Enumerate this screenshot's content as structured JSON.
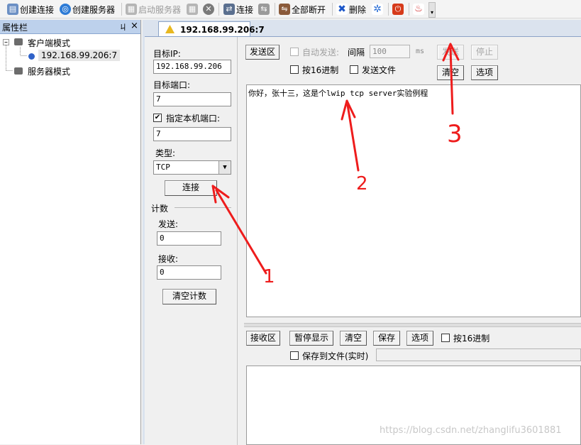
{
  "toolbar": {
    "create_connection": "创建连接",
    "create_server": "创建服务器",
    "start_server": "启动服务器",
    "connect": "连接",
    "disconnect_all": "全部断开",
    "delete": "删除"
  },
  "sidebar": {
    "title": "属性栏",
    "pin": "ㄐ",
    "close": "×",
    "client_mode": "客户端模式",
    "client_item": "192.168.99.206:7",
    "server_mode": "服务器模式"
  },
  "tab": {
    "label": "192.168.99.206:7"
  },
  "config": {
    "target_ip_label": "目标IP:",
    "target_ip": "192.168.99.206",
    "target_port_label": "目标端口:",
    "target_port": "7",
    "local_port_label": "指定本机端口:",
    "local_port": "7",
    "type_label": "类型:",
    "type_value": "TCP",
    "connect_button": "连接",
    "counter_label": "计数",
    "send_label": "发送:",
    "send_count": "0",
    "recv_label": "接收:",
    "recv_count": "0",
    "clear_count": "清空计数"
  },
  "send_area": {
    "title": "发送区",
    "auto_send": "自动发送:",
    "interval_label": "间隔",
    "interval_value": "100",
    "interval_unit": "ms",
    "send_button": "发送",
    "stop_button": "停止",
    "hex": "按16进制",
    "send_file": "发送文件",
    "clear_button": "清空",
    "options_button": "选项",
    "content": "你好，张十三，这是个lwip tcp server实验例程"
  },
  "recv_area": {
    "title": "接收区",
    "pause": "暂停显示",
    "clear": "清空",
    "save": "保存",
    "options": "选项",
    "hex": "按16进制",
    "save_to_file": "保存到文件(实时)"
  },
  "annotations": {
    "a1": "1",
    "a2": "2",
    "a3": "3"
  },
  "watermark": "https://blog.csdn.net/zhanglifu3601881",
  "colors": {
    "arrow": "#ee1c1c",
    "sidebar_header": "#bdd1ec",
    "tab_border": "#8ca3c7"
  }
}
